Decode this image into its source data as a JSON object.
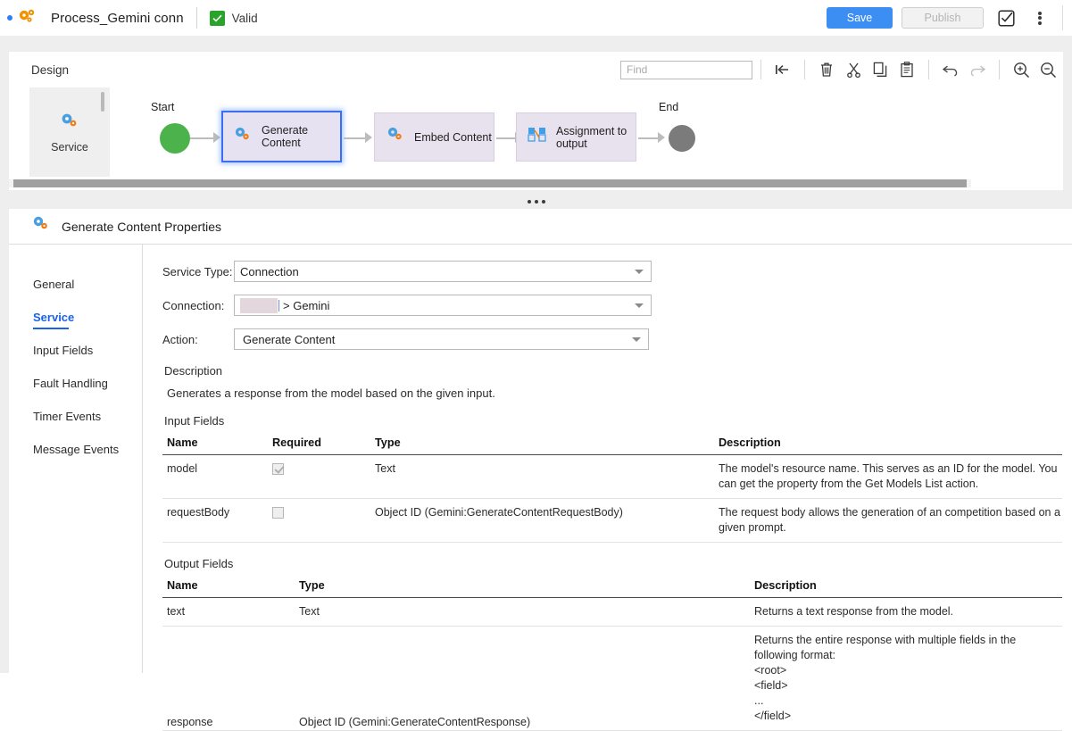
{
  "topbar": {
    "process_title": "Process_Gemini conn",
    "status_label": "Valid",
    "status_icon": "check-icon",
    "save_label": "Save",
    "publish_label": "Publish",
    "validate_icon": "checkbox-validate-icon",
    "more_icon": "kebab-menu-icon",
    "logo_icon": "gears-logo-icon",
    "accent_color": "#3c8ef3",
    "valid_color": "#2aa32a"
  },
  "design": {
    "panel_label": "Design",
    "find_placeholder": "Find",
    "find_value": "",
    "tools": [
      {
        "name": "go-to-start-icon",
        "title": "Go to start"
      },
      {
        "name": "delete-icon",
        "title": "Delete"
      },
      {
        "name": "cut-icon",
        "title": "Cut"
      },
      {
        "name": "copy-icon",
        "title": "Copy"
      },
      {
        "name": "paste-icon",
        "title": "Paste"
      },
      {
        "name": "undo-icon",
        "title": "Undo"
      },
      {
        "name": "redo-icon",
        "title": "Redo"
      },
      {
        "name": "zoom-in-icon",
        "title": "Zoom in"
      },
      {
        "name": "zoom-out-icon",
        "title": "Zoom out"
      }
    ],
    "palette": {
      "label": "Service",
      "icon": "gears-icon"
    },
    "canvas": {
      "start_label": "Start",
      "end_label": "End",
      "nodes": [
        {
          "label": "Generate Content",
          "icon": "gears-icon",
          "selected": true
        },
        {
          "label": "Embed Content",
          "icon": "gears-icon",
          "selected": false
        },
        {
          "label": "Assignment to output",
          "icon": "assignment-icon",
          "selected": false
        }
      ]
    }
  },
  "properties": {
    "title": "Generate Content Properties",
    "icon": "gears-icon",
    "tabs": [
      {
        "label": "General",
        "active": false
      },
      {
        "label": "Service",
        "active": true
      },
      {
        "label": "Input Fields",
        "active": false
      },
      {
        "label": "Fault Handling",
        "active": false
      },
      {
        "label": "Timer Events",
        "active": false
      },
      {
        "label": "Message Events",
        "active": false
      }
    ],
    "fields": {
      "service_type_label": "Service Type:",
      "service_type_value": "Connection",
      "connection_label": "Connection:",
      "connection_value": "> Gemini",
      "action_label": "Action:",
      "action_value": "Generate Content"
    },
    "description_heading": "Description",
    "description_text": "Generates a response from the model based on the given input.",
    "input_fields": {
      "heading": "Input Fields",
      "columns": [
        "Name",
        "Required",
        "Type",
        "Description"
      ],
      "rows": [
        {
          "name": "model",
          "required": true,
          "type": "Text",
          "description": "The model's resource name. This serves as an ID for the model. You can get the property from the Get Models List action."
        },
        {
          "name": "requestBody",
          "required": false,
          "type": "Object ID (Gemini:GenerateContentRequestBody)",
          "description": "The request body allows the generation of an competition based on a given prompt."
        }
      ]
    },
    "output_fields": {
      "heading": "Output Fields",
      "columns": [
        "Name",
        "Type",
        "Description"
      ],
      "rows": [
        {
          "name": "text",
          "type": "Text",
          "description": "Returns a text response from the model."
        },
        {
          "name": "response",
          "type": "Object ID (Gemini:GenerateContentResponse)",
          "description": "Returns the entire response with multiple fields in the following format:\n<root>\n<field>\n...\n</field>"
        }
      ]
    }
  }
}
